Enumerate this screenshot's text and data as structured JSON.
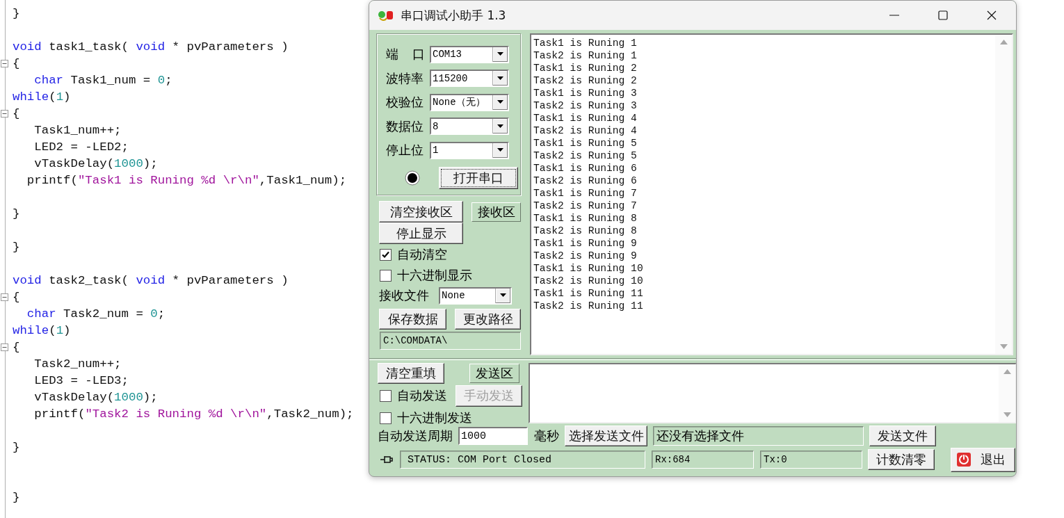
{
  "editor": {
    "lines": [
      {
        "fold": false,
        "tokens": [
          {
            "kind": "plain",
            "text": "}"
          }
        ]
      },
      {
        "fold": false
      },
      {
        "fold": false,
        "tokens": [
          {
            "kind": "keyword",
            "text": "void"
          },
          {
            "kind": "plain",
            "text": " task1_task( "
          },
          {
            "kind": "keyword",
            "text": "void"
          },
          {
            "kind": "plain",
            "text": " * pvParameters )"
          }
        ]
      },
      {
        "fold": true,
        "tokens": [
          {
            "kind": "plain",
            "text": "{"
          }
        ]
      },
      {
        "fold": false,
        "tokens": [
          {
            "kind": "keyword",
            "text": "   char"
          },
          {
            "kind": "plain",
            "text": " Task1_num = "
          },
          {
            "kind": "number",
            "text": "0"
          },
          {
            "kind": "plain",
            "text": ";"
          }
        ]
      },
      {
        "fold": false,
        "tokens": [
          {
            "kind": "keyword",
            "text": "while"
          },
          {
            "kind": "plain",
            "text": "("
          },
          {
            "kind": "number",
            "text": "1"
          },
          {
            "kind": "plain",
            "text": ")"
          }
        ]
      },
      {
        "fold": true,
        "tokens": [
          {
            "kind": "plain",
            "text": "{"
          }
        ]
      },
      {
        "fold": false,
        "tokens": [
          {
            "kind": "plain",
            "text": "   Task1_num++;"
          }
        ]
      },
      {
        "fold": false,
        "tokens": [
          {
            "kind": "plain",
            "text": "   LED2 = -LED2;"
          }
        ]
      },
      {
        "fold": false,
        "tokens": [
          {
            "kind": "plain",
            "text": "   vTaskDelay("
          },
          {
            "kind": "number",
            "text": "1000"
          },
          {
            "kind": "plain",
            "text": ");"
          }
        ]
      },
      {
        "fold": false,
        "tokens": [
          {
            "kind": "plain",
            "text": "  printf("
          },
          {
            "kind": "string",
            "text": "\"Task1 is Runing %d \\r\\n\""
          },
          {
            "kind": "plain",
            "text": ",Task1_num);"
          }
        ]
      },
      {
        "fold": false
      },
      {
        "fold": false,
        "tokens": [
          {
            "kind": "plain",
            "text": "}"
          }
        ]
      },
      {
        "fold": false
      },
      {
        "fold": false,
        "tokens": [
          {
            "kind": "plain",
            "text": "}"
          }
        ]
      },
      {
        "fold": false
      },
      {
        "fold": false,
        "tokens": [
          {
            "kind": "keyword",
            "text": "void"
          },
          {
            "kind": "plain",
            "text": " task2_task( "
          },
          {
            "kind": "keyword",
            "text": "void"
          },
          {
            "kind": "plain",
            "text": " * pvParameters )"
          }
        ]
      },
      {
        "fold": true,
        "tokens": [
          {
            "kind": "plain",
            "text": "{"
          }
        ]
      },
      {
        "fold": false,
        "tokens": [
          {
            "kind": "keyword",
            "text": "  char"
          },
          {
            "kind": "plain",
            "text": " Task2_num = "
          },
          {
            "kind": "number",
            "text": "0"
          },
          {
            "kind": "plain",
            "text": ";"
          }
        ]
      },
      {
        "fold": false,
        "tokens": [
          {
            "kind": "keyword",
            "text": "while"
          },
          {
            "kind": "plain",
            "text": "("
          },
          {
            "kind": "number",
            "text": "1"
          },
          {
            "kind": "plain",
            "text": ")"
          }
        ]
      },
      {
        "fold": true,
        "tokens": [
          {
            "kind": "plain",
            "text": "{"
          }
        ]
      },
      {
        "fold": false,
        "tokens": [
          {
            "kind": "plain",
            "text": "   Task2_num++;"
          }
        ]
      },
      {
        "fold": false,
        "tokens": [
          {
            "kind": "plain",
            "text": "   LED3 = -LED3;"
          }
        ]
      },
      {
        "fold": false,
        "tokens": [
          {
            "kind": "plain",
            "text": "   vTaskDelay("
          },
          {
            "kind": "number",
            "text": "1000"
          },
          {
            "kind": "plain",
            "text": ");"
          }
        ]
      },
      {
        "fold": false,
        "tokens": [
          {
            "kind": "plain",
            "text": "   printf("
          },
          {
            "kind": "string",
            "text": "\"Task2 is Runing %d \\r\\n\""
          },
          {
            "kind": "plain",
            "text": ",Task2_num);"
          }
        ]
      },
      {
        "fold": false
      },
      {
        "fold": false,
        "tokens": [
          {
            "kind": "plain",
            "text": "}"
          }
        ]
      },
      {
        "fold": false
      },
      {
        "fold": false
      },
      {
        "fold": false,
        "tokens": [
          {
            "kind": "plain",
            "text": "}"
          }
        ]
      }
    ]
  },
  "window": {
    "title": "串口调试小助手 1.3"
  },
  "port_settings": {
    "fields": [
      {
        "label": "端 口",
        "value": "COM13"
      },
      {
        "label": "波特率",
        "value": "115200"
      },
      {
        "label": "校验位",
        "value": "None（无）"
      },
      {
        "label": "数据位",
        "value": "8"
      },
      {
        "label": "停止位",
        "value": "1"
      }
    ],
    "lamp": {
      "on": false
    },
    "open_button": "打开串口"
  },
  "receive": {
    "clear_button": "清空接收区",
    "area_label": "接收区",
    "stop_button": "停止显示",
    "auto_clear": {
      "label": "自动清空",
      "checked": true
    },
    "hex_display": {
      "label": "十六进制显示",
      "checked": false
    },
    "file_label": "接收文件",
    "file_value": "None",
    "save_button": "保存数据",
    "path_button": "更改路径",
    "path": "C:\\COMDATA\\",
    "lines": [
      "Task1 is Runing 1",
      "Task2 is Runing 1",
      "Task1 is Runing 2",
      "Task2 is Runing 2",
      "Task1 is Runing 3",
      "Task2 is Runing 3",
      "Task1 is Runing 4",
      "Task2 is Runing 4",
      "Task1 is Runing 5",
      "Task2 is Runing 5",
      "Task1 is Runing 6",
      "Task2 is Runing 6",
      "Task1 is Runing 7",
      "Task2 is Runing 7",
      "Task1 is Runing 8",
      "Task2 is Runing 8",
      "Task1 is Runing 9",
      "Task2 is Runing 9",
      "Task1 is Runing 10",
      "Task2 is Runing 10",
      "Task1 is Runing 11",
      "Task2 is Runing 11"
    ]
  },
  "send": {
    "clear_button": "清空重填",
    "area_label": "发送区",
    "auto_send": {
      "label": "自动发送",
      "checked": false
    },
    "manual_button": {
      "label": "手动发送",
      "disabled": true
    },
    "hex_send": {
      "label": "十六进制发送",
      "checked": false
    },
    "period_label": "自动发送周期",
    "period_value": "1000",
    "unit": "毫秒",
    "choose_file_button": "选择发送文件",
    "file_status": "还没有选择文件",
    "send_file_button": "发送文件"
  },
  "status_bar": {
    "status": "STATUS: COM Port Closed",
    "rx": "Rx:684",
    "tx": "Tx:0",
    "reset_button": "计数清零",
    "exit_button": "退出"
  }
}
